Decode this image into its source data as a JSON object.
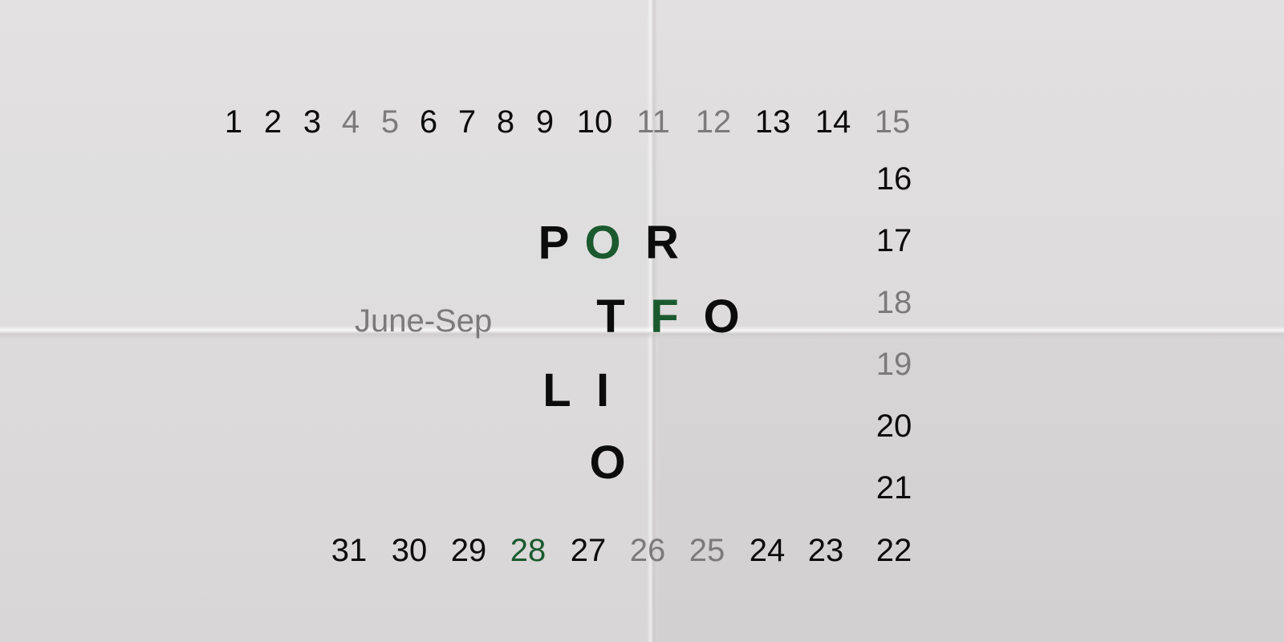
{
  "colors": {
    "black": "#0c0c0c",
    "grey": "#7c7a7a",
    "green": "#1a5a2e",
    "paper": "#dfdddd"
  },
  "subtitle": "June-Sep",
  "top_row": [
    {
      "label": "1",
      "tone": "black"
    },
    {
      "label": "2",
      "tone": "black"
    },
    {
      "label": "3",
      "tone": "black"
    },
    {
      "label": "4",
      "tone": "grey"
    },
    {
      "label": "5",
      "tone": "grey"
    },
    {
      "label": "6",
      "tone": "black"
    },
    {
      "label": "7",
      "tone": "black"
    },
    {
      "label": "8",
      "tone": "black"
    },
    {
      "label": "9",
      "tone": "black"
    },
    {
      "label": "10",
      "tone": "black"
    },
    {
      "label": "11",
      "tone": "grey"
    },
    {
      "label": "12",
      "tone": "grey"
    },
    {
      "label": "13",
      "tone": "black"
    },
    {
      "label": "14",
      "tone": "black"
    },
    {
      "label": "15",
      "tone": "grey"
    }
  ],
  "right_column": [
    {
      "label": "16",
      "tone": "black"
    },
    {
      "label": "17",
      "tone": "black"
    },
    {
      "label": "18",
      "tone": "grey"
    },
    {
      "label": "19",
      "tone": "grey"
    },
    {
      "label": "20",
      "tone": "black"
    },
    {
      "label": "21",
      "tone": "black"
    },
    {
      "label": "22",
      "tone": "black"
    }
  ],
  "bottom_row": [
    {
      "label": "31",
      "tone": "black"
    },
    {
      "label": "30",
      "tone": "black"
    },
    {
      "label": "29",
      "tone": "black"
    },
    {
      "label": "28",
      "tone": "green"
    },
    {
      "label": "27",
      "tone": "black"
    },
    {
      "label": "26",
      "tone": "grey"
    },
    {
      "label": "25",
      "tone": "grey"
    },
    {
      "label": "24",
      "tone": "black"
    },
    {
      "label": "23",
      "tone": "black"
    }
  ],
  "title_letters": [
    {
      "char": "P",
      "tone": "black"
    },
    {
      "char": "O",
      "tone": "green"
    },
    {
      "char": "R",
      "tone": "black"
    },
    {
      "char": "T",
      "tone": "black"
    },
    {
      "char": "F",
      "tone": "green"
    },
    {
      "char": "O",
      "tone": "black"
    },
    {
      "char": "L",
      "tone": "black"
    },
    {
      "char": "I",
      "tone": "black"
    },
    {
      "char": "O",
      "tone": "black"
    }
  ]
}
